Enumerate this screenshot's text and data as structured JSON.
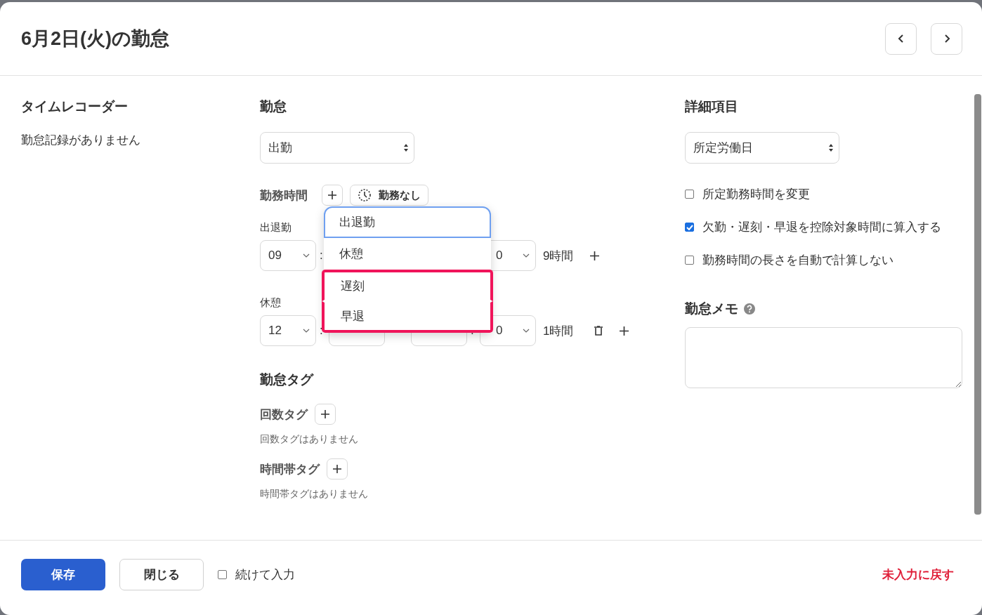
{
  "dialog": {
    "title": "6月2日(火)の勤怠"
  },
  "time_recorder": {
    "heading": "タイムレコーダー",
    "empty": "勤怠記録がありません"
  },
  "attendance": {
    "heading": "勤怠",
    "type_select": "出勤",
    "work_time_label": "勤務時間",
    "separator": ":",
    "no_work_button": "勤務なし",
    "rows": [
      {
        "label": "出退勤",
        "start_hour": "09",
        "end_minute": "0",
        "duration": "9時間",
        "deletable": false
      },
      {
        "label": "休憩",
        "start_hour": "12",
        "end_minute": "0",
        "duration": "1時間",
        "deletable": true
      }
    ],
    "dropdown": [
      {
        "label": "出退勤",
        "selected": true,
        "highlighted": false
      },
      {
        "label": "休憩",
        "selected": false,
        "highlighted": false
      },
      {
        "label": "遅刻",
        "selected": false,
        "highlighted": true
      },
      {
        "label": "早退",
        "selected": false,
        "highlighted": true
      }
    ]
  },
  "tags": {
    "heading": "勤怠タグ",
    "groups": [
      {
        "label": "回数タグ",
        "empty": "回数タグはありません"
      },
      {
        "label": "時間帯タグ",
        "empty": "時間帯タグはありません"
      }
    ]
  },
  "details": {
    "heading": "詳細項目",
    "select": "所定労働日",
    "checkboxes": [
      {
        "label": "所定勤務時間を変更",
        "checked": false
      },
      {
        "label": "欠勤・遅刻・早退を控除対象時間に算入する",
        "checked": true
      },
      {
        "label": "勤務時間の長さを自動で計算しない",
        "checked": false
      }
    ],
    "memo_heading": "勤怠メモ"
  },
  "footer": {
    "save": "保存",
    "close": "閉じる",
    "continue": {
      "label": "続けて入力",
      "checked": false
    },
    "reset": "未入力に戻す"
  }
}
